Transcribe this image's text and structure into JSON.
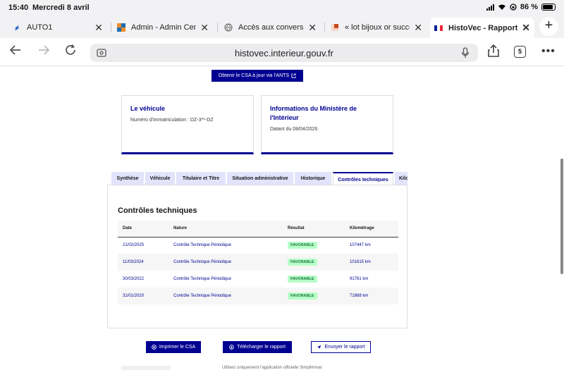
{
  "status_bar": {
    "time": "15:40",
    "date": "Mercredi 8 avril",
    "battery": "86 %",
    "battery_level": 0.86
  },
  "browser": {
    "tabs": [
      {
        "label": "AUTO1",
        "icon": "auto1-favicon"
      },
      {
        "label": "Admin - Admin Cent",
        "icon": "admin-favicon"
      },
      {
        "label": "Accès aux conversa",
        "icon": "globe-icon"
      },
      {
        "label": "« lot bijoux or succe",
        "icon": "shop-favicon"
      },
      {
        "label": "HistoVec - Rapport d",
        "icon": "french-flag-favicon",
        "active": true
      }
    ],
    "url": "histovec.interieur.gouv.fr",
    "tab_count": "5"
  },
  "page": {
    "ants_button": "Obtenir le CSA à jour via l'ANTS",
    "vehicle_card": {
      "title": "Le véhicule",
      "registration": "Numéro d'immatriculation : DZ-3**-DZ"
    },
    "ministry_card": {
      "title": "Informations du Ministère de l'Intérieur",
      "date": "Datant du 08/04/2026"
    },
    "tabs": [
      {
        "label": "Synthèse"
      },
      {
        "label": "Véhicule"
      },
      {
        "label": "Titulaire et Titre"
      },
      {
        "label": "Situation administrative"
      },
      {
        "label": "Historique"
      },
      {
        "label": "Contrôles techniques",
        "active": true
      },
      {
        "label": "Kilo"
      }
    ],
    "section_title": "Contrôles techniques",
    "table": {
      "headers": [
        "Date",
        "Nature",
        "Résultat",
        "Kilométrage"
      ],
      "rows": [
        {
          "date": "21/02/2025",
          "nature": "Contrôle Technique Périodique",
          "result": "FAVORABLE",
          "km": "107447 km"
        },
        {
          "date": "11/03/2024",
          "nature": "Contrôle Technique Périodique",
          "result": "FAVORABLE",
          "km": "101615 km"
        },
        {
          "date": "30/03/2022",
          "nature": "Contrôle Technique Périodique",
          "result": "FAVORABLE",
          "km": "91761 km"
        },
        {
          "date": "31/01/2020",
          "nature": "Contrôle Technique Périodique",
          "result": "FAVORABLE",
          "km": "71868 km"
        }
      ]
    },
    "buttons": {
      "print": "Imprimer le CSA",
      "download": "Télécharger le rapport",
      "send": "Envoyer le rapport"
    },
    "footer_text": "Utilisez uniquement l'application officielle Simplimmat"
  },
  "colors": {
    "accent": "#000091",
    "success_bg": "#b8fec9",
    "success_text": "#18753c"
  }
}
